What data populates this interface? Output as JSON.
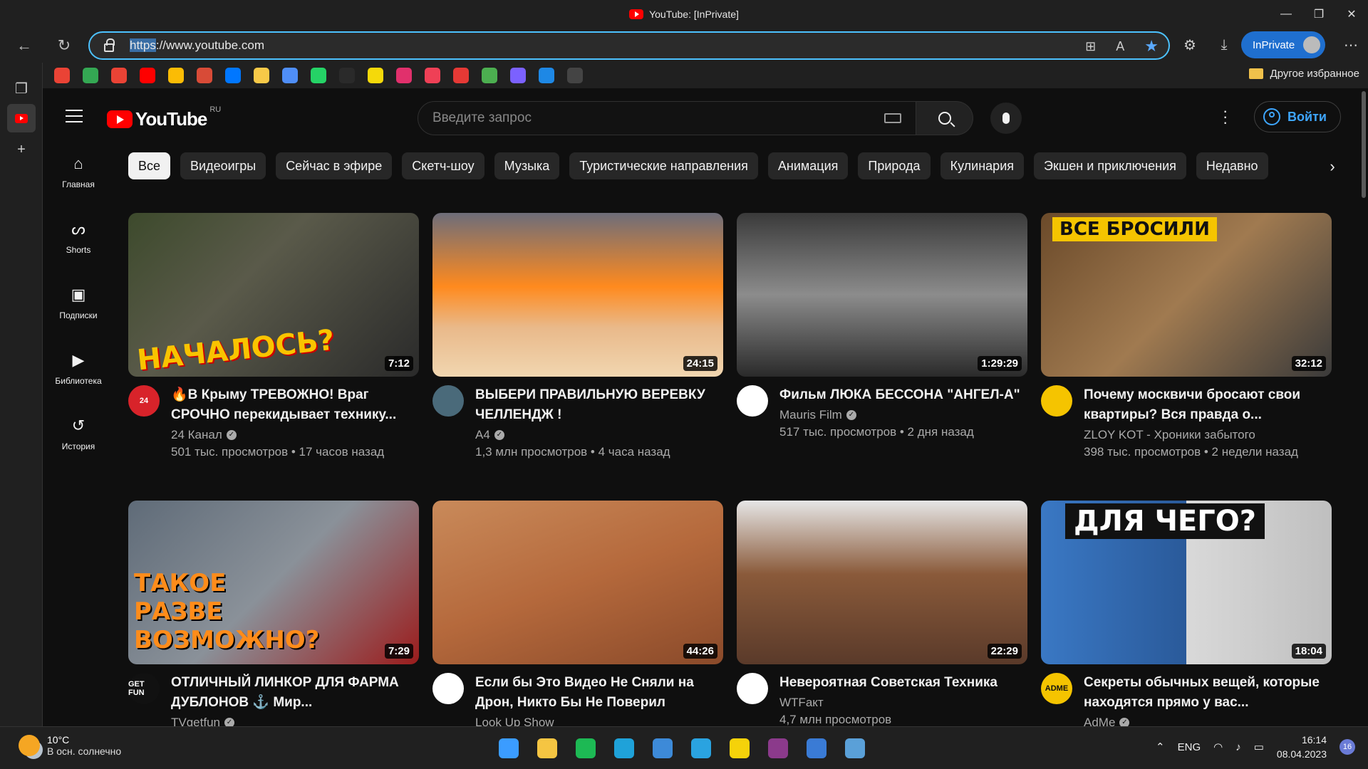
{
  "window": {
    "title": "YouTube: [InPrivate]"
  },
  "browser": {
    "url_scheme": "https",
    "url_rest": "://www.youtube.com",
    "inprivate_label": "InPrivate",
    "other_favorites": "Другое избранное"
  },
  "favorites_icons": [
    {
      "name": "gmail-icon",
      "color": "#ea4335"
    },
    {
      "name": "google-drive-icon",
      "color": "#34a853"
    },
    {
      "name": "google-maps-icon",
      "color": "#ea4335"
    },
    {
      "name": "youtube-icon",
      "color": "#ff0000"
    },
    {
      "name": "google-photos-icon",
      "color": "#fbbc05"
    },
    {
      "name": "app-icon",
      "color": "#d84b37"
    },
    {
      "name": "vk-icon",
      "color": "#0077ff"
    },
    {
      "name": "notes-icon",
      "color": "#f7c948"
    },
    {
      "name": "app-4-icon",
      "color": "#4f8ef7"
    },
    {
      "name": "whatsapp-icon",
      "color": "#25d366"
    },
    {
      "name": "spotify-icon",
      "color": "#2a2a2a"
    },
    {
      "name": "app-yellow-icon",
      "color": "#f5d90a"
    },
    {
      "name": "instagram-icon",
      "color": "#e1306c"
    },
    {
      "name": "pocket-icon",
      "color": "#ef4056"
    },
    {
      "name": "app-red-icon",
      "color": "#e53935"
    },
    {
      "name": "app-dots-icon",
      "color": "#4caf50"
    },
    {
      "name": "app-puzzle-icon",
      "color": "#7b61ff"
    },
    {
      "name": "app-blue-icon",
      "color": "#1e88e5"
    },
    {
      "name": "openai-icon",
      "color": "#444444"
    }
  ],
  "youtube": {
    "logo_text": "YouTube",
    "country_code": "RU",
    "search_placeholder": "Введите запрос",
    "signin_label": "Войти",
    "guide": [
      {
        "label": "Главная",
        "icon": "home-icon",
        "glyph": "⌂"
      },
      {
        "label": "Shorts",
        "icon": "shorts-icon",
        "glyph": "ᔕ"
      },
      {
        "label": "Подписки",
        "icon": "subscriptions-icon",
        "glyph": "▣"
      },
      {
        "label": "Библиотека",
        "icon": "library-icon",
        "glyph": "▶"
      },
      {
        "label": "История",
        "icon": "history-icon",
        "glyph": "↺"
      }
    ],
    "chips": [
      "Все",
      "Видеоигры",
      "Сейчас в эфире",
      "Скетч-шоу",
      "Музыка",
      "Туристические направления",
      "Анимация",
      "Природа",
      "Кулинария",
      "Экшен и приключения",
      "Недавно"
    ],
    "videos": [
      {
        "title": "🔥В Крыму ТРЕВОЖНО! Враг СРОЧНО перекидывает технику...",
        "channel": "24 Канал",
        "verified": true,
        "stats": "501 тыс. просмотров • 17 часов назад",
        "duration": "7:12",
        "overlay": "НАЧАЛОСЬ?",
        "thumb_bg": "linear-gradient(135deg,#3d4a2c 0%,#5a5a4a 40%,#2a2a2a 100%)",
        "overlay_color": "#f9c400",
        "avatar_bg": "#d8232a",
        "avatar_text": "24"
      },
      {
        "title": "ВЫБЕРИ ПРАВИЛЬНУЮ ВЕРЕВКУ ЧЕЛЛЕНДЖ !",
        "channel": "A4",
        "verified": true,
        "stats": "1,3 млн просмотров • 4 часа назад",
        "duration": "24:15",
        "overlay": "",
        "thumb_bg": "linear-gradient(180deg,#6d6d7a 0%,#ff8a1e 45%,#e9b98a 70%,#f1d6b0 100%)",
        "overlay_color": "#ffffff",
        "avatar_bg": "#4a6a7a",
        "avatar_text": ""
      },
      {
        "title": "Фильм ЛЮКА БЕССОНА \"АНГЕЛ-А\"",
        "channel": "Mauris Film",
        "verified": true,
        "stats": "517 тыс. просмотров • 2 дня назад",
        "duration": "1:29:29",
        "overlay": "",
        "thumb_bg": "linear-gradient(180deg,#3a3a3a 0%,#8c8c8c 50%,#2a2a2a 100%)",
        "overlay_color": "#ffffff",
        "avatar_bg": "#ffffff",
        "avatar_text": ""
      },
      {
        "title": "Почему москвичи бросают свои квартиры? Вся правда о...",
        "channel": "ZLOY KOT - Хроники забытого",
        "verified": false,
        "stats": "398 тыс. просмотров • 2 недели назад",
        "duration": "32:12",
        "overlay": "ВСЕ БРОСИЛИ",
        "thumb_bg": "linear-gradient(135deg,#6b4a2a 0%,#a07a50 50%,#3a3a3a 100%)",
        "overlay_color": "#111111",
        "avatar_bg": "#f5c400",
        "avatar_text": ""
      },
      {
        "title": "ОТЛИЧНЫЙ ЛИНКОР ДЛЯ ФАРМА ДУБЛОНОВ ⚓ Мир...",
        "channel": "TVgetfun",
        "verified": true,
        "stats": "",
        "duration": "7:29",
        "overlay": "ТАКОЕ РАЗВЕ ВОЗМОЖНО?",
        "thumb_bg": "linear-gradient(135deg,#5f6b78 0%,#8a9199 50%,#9b1c1c 100%)",
        "overlay_color": "#ff8c1a",
        "avatar_bg": "#111111",
        "avatar_text": "GET FUN"
      },
      {
        "title": "Если бы Это Видео Не Сняли на Дрон, Никто Бы Не Поверил",
        "channel": "Look Up Show",
        "verified": false,
        "stats": "",
        "duration": "44:26",
        "overlay": "",
        "thumb_bg": "linear-gradient(160deg,#c98a5a 0%,#b5693c 50%,#8a4a2a 100%)",
        "overlay_color": "#ffffff",
        "avatar_bg": "#ffffff",
        "avatar_text": ""
      },
      {
        "title": "Невероятная Советская Техника",
        "channel": "WTFакт",
        "verified": false,
        "stats": "4,7 млн просмотров",
        "duration": "22:29",
        "overlay": "",
        "thumb_bg": "linear-gradient(180deg,#e6e6e6 0%,#8a5a3a 45%,#5a3a2a 100%)",
        "overlay_color": "#ffffff",
        "avatar_bg": "#ffffff",
        "avatar_text": ""
      },
      {
        "title": "Секреты обычных вещей, которые находятся прямо у вас...",
        "channel": "AdMe",
        "verified": true,
        "stats": "",
        "duration": "18:04",
        "overlay": "ДЛЯ ЧЕГО?",
        "thumb_bg": "linear-gradient(90deg,#3a78c4 0%,#2a5a9a 50%,#d9d9d9 50%,#bfbfbf 100%)",
        "overlay_color": "#ffffff",
        "avatar_bg": "#f5c400",
        "avatar_text": "ADME"
      }
    ]
  },
  "taskbar": {
    "temperature": "10°C",
    "weather": "В осн. солнечно",
    "lang": "ENG",
    "time": "16:14",
    "date": "08.04.2023",
    "notifications": "16",
    "apps": [
      {
        "name": "start-icon",
        "color": "#3b9cff"
      },
      {
        "name": "file-explorer-icon",
        "color": "#f5c542"
      },
      {
        "name": "spotify-icon",
        "color": "#1db954"
      },
      {
        "name": "edge-icon",
        "color": "#1fa2d9"
      },
      {
        "name": "qbittorrent-icon",
        "color": "#3d8ad8"
      },
      {
        "name": "telegram-icon",
        "color": "#2aa3e0"
      },
      {
        "name": "player-icon",
        "color": "#f5d20a"
      },
      {
        "name": "winrar-icon",
        "color": "#8b3a8b"
      },
      {
        "name": "messenger-icon",
        "color": "#3a7bd5"
      },
      {
        "name": "photos-icon",
        "color": "#5aa0d8"
      }
    ]
  }
}
